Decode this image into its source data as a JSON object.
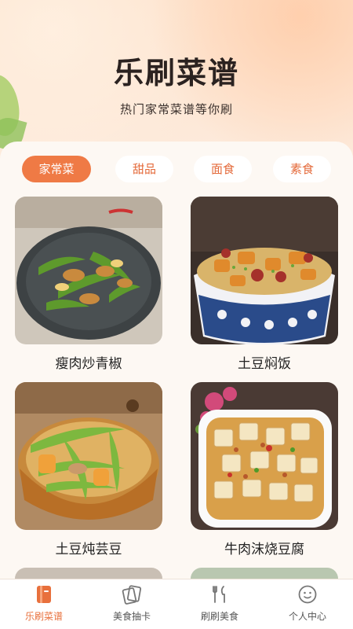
{
  "app": {
    "title": "乐刷菜谱",
    "subtitle": "热门家常菜谱等你刷"
  },
  "tabs": [
    {
      "label": "家常菜",
      "active": true
    },
    {
      "label": "甜品",
      "active": false
    },
    {
      "label": "面食",
      "active": false
    },
    {
      "label": "素食",
      "active": false
    }
  ],
  "recipes": [
    {
      "title": "瘦肉炒青椒",
      "icon": "stir-fry-pepper-photo"
    },
    {
      "title": "土豆焖饭",
      "icon": "potato-rice-photo"
    },
    {
      "title": "土豆炖芸豆",
      "icon": "potato-bean-stew-photo"
    },
    {
      "title": "牛肉沫烧豆腐",
      "icon": "beef-tofu-photo"
    }
  ],
  "nav": [
    {
      "label": "乐刷菜谱",
      "icon": "recipe-book-icon",
      "active": true
    },
    {
      "label": "美食抽卡",
      "icon": "card-draw-icon",
      "active": false
    },
    {
      "label": "刷刷美食",
      "icon": "fork-knife-icon",
      "active": false
    },
    {
      "label": "个人中心",
      "icon": "smiley-face-icon",
      "active": false
    }
  ],
  "colors": {
    "accent": "#ef7a45",
    "nav_active": "#e8703c"
  }
}
